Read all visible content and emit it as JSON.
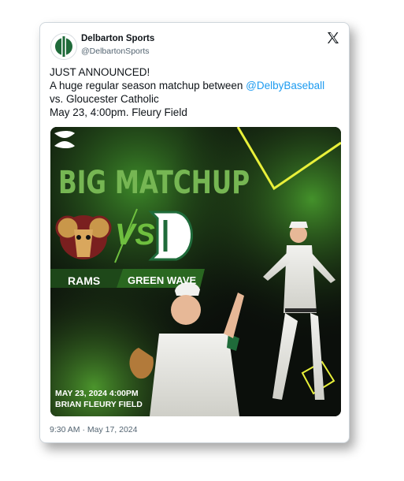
{
  "author": {
    "name": "Delbarton Sports",
    "handle": "@DelbartonSports"
  },
  "post": {
    "line1": "JUST ANNOUNCED!",
    "line2_prefix": "A huge regular season matchup between ",
    "mention": "@DelbyBaseball",
    "line3": "vs. Gloucester Catholic",
    "line4": "May 23, 4:00pm.  Fleury Field",
    "timestamp": "9:30 AM · May 17, 2024"
  },
  "graphic": {
    "headline": "BIG MATCHUP",
    "versus": "VS",
    "team_left": "RAMS",
    "team_right": "GREEN WAVE",
    "date_time": "MAY 23, 2024 4:00PM",
    "venue": "BRIAN FLEURY FIELD",
    "logo_left_icon": "ram-mascot-icon",
    "logo_right_icon": "gothic-d-logo-icon",
    "brand_icon": "under-armour-logo-icon"
  },
  "colors": {
    "mention": "#1d9bf0",
    "accent_green": "#6fbf3f",
    "neon_yellow": "#e8f03a"
  }
}
